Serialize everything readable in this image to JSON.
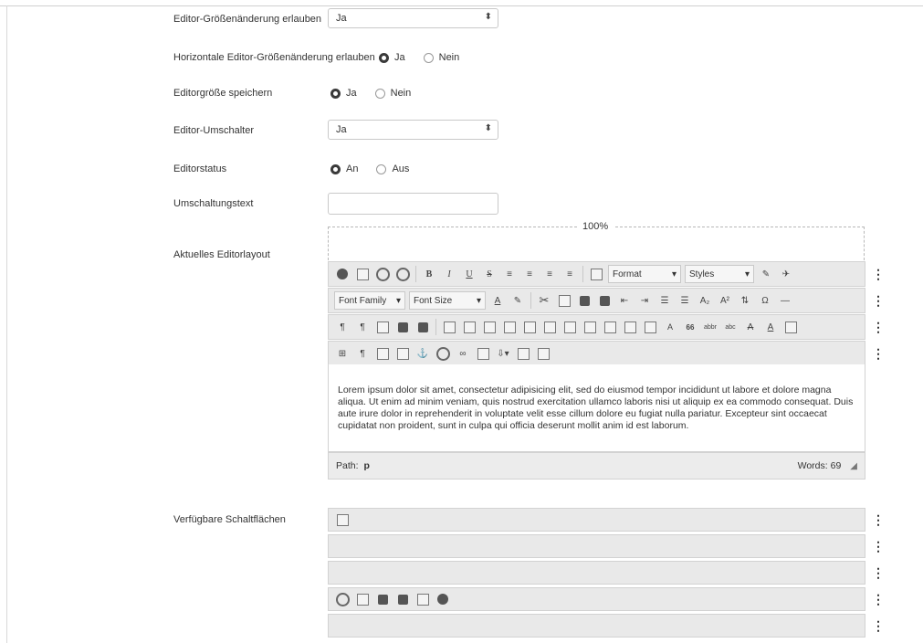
{
  "form": {
    "resize_label": "Editor-Größenänderung erlauben",
    "resize_value": "Ja",
    "hresize_label": "Horizontale Editor-Größenänderung erlauben",
    "hresize_options": [
      "Ja",
      "Nein"
    ],
    "hresize_selected": "Ja",
    "save_size_label": "Editorgröße speichern",
    "save_size_options": [
      "Ja",
      "Nein"
    ],
    "save_size_selected": "Ja",
    "toggle_label": "Editor-Umschalter",
    "toggle_value": "Ja",
    "status_label": "Editorstatus",
    "status_options": [
      "An",
      "Aus"
    ],
    "status_selected": "An",
    "toggle_text_label": "Umschaltungstext",
    "toggle_text_value": "",
    "layout_label": "Aktuelles Editorlayout",
    "width_percent": "100%",
    "available_label": "Verfügbare Schaltflächen"
  },
  "toolbar": {
    "format_label": "Format",
    "styles_label": "Styles",
    "font_family_label": "Font Family",
    "font_size_label": "Font Size"
  },
  "editor": {
    "content": "Lorem ipsum dolor sit amet, consectetur adipisicing elit, sed do eiusmod tempor incididunt ut labore et dolore magna aliqua. Ut enim ad minim veniam, quis nostrud exercitation ullamco laboris nisi ut aliquip ex ea commodo consequat. Duis aute irure dolor in reprehenderit in voluptate velit esse cillum dolore eu fugiat nulla pariatur. Excepteur sint occaecat cupidatat non proident, sunt in culpa qui officia deserunt mollit anim id est laborum.",
    "path_label": "Path:",
    "path_value": "p",
    "words_label": "Words: 69"
  }
}
